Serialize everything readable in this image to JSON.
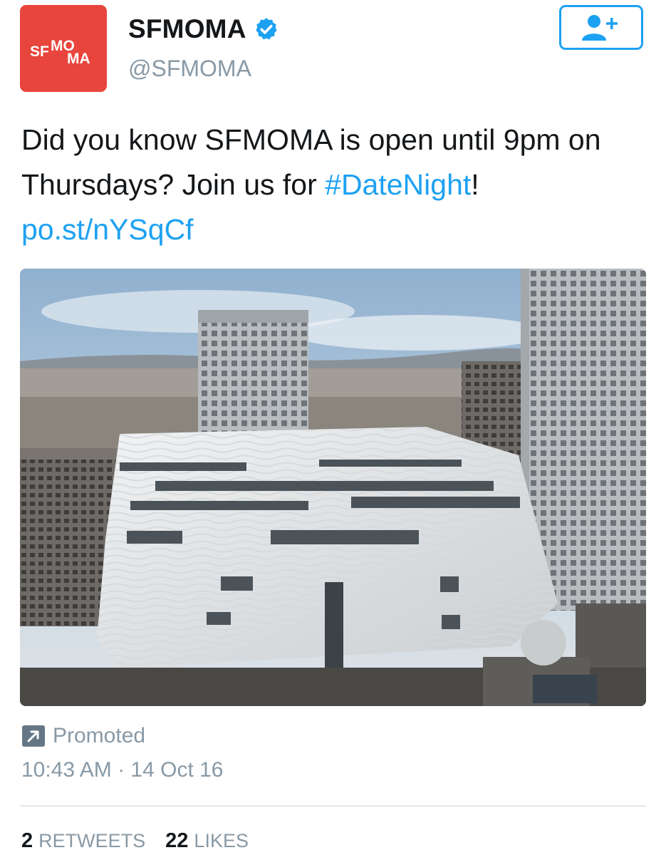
{
  "account": {
    "avatar_alt": "SFMOMA",
    "avatar_text_line1a": "SF",
    "avatar_text_line1b": "MO",
    "avatar_text_line2": "MA",
    "display_name": "SFMOMA",
    "handle": "@SFMOMA",
    "verified": true,
    "avatar_color": "#e8453c"
  },
  "follow_button": {
    "icon": "add-user-icon"
  },
  "tweet": {
    "text_part1": "Did you know SFMOMA is open until 9pm on Thursdays? Join us for ",
    "hashtag": "#DateNight",
    "text_part2": "!",
    "link": "po.st/nYSqCf"
  },
  "media": {
    "description": "SFMOMA building photo"
  },
  "meta": {
    "promoted_label": "Promoted",
    "timestamp": "10:43 AM · 14 Oct 16"
  },
  "stats": {
    "retweets_count": "2",
    "retweets_label": "RETWEETS",
    "likes_count": "22",
    "likes_label": "LIKES"
  },
  "colors": {
    "accent": "#1da1f2",
    "secondary_text": "#8899a6",
    "brand": "#e8453c"
  }
}
